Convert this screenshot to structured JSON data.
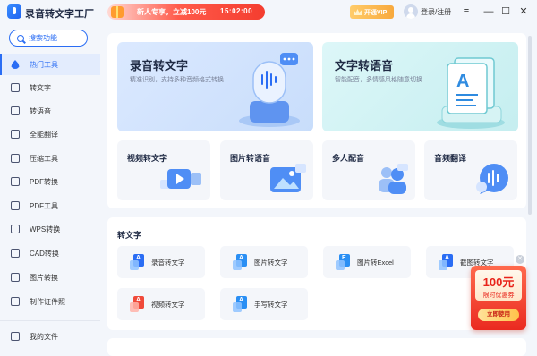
{
  "app": {
    "title": "录音转文字工厂"
  },
  "promo": {
    "text": "新人专享，立减100元",
    "countdown": "15:02:00"
  },
  "header": {
    "vip_label": "开通VIP",
    "login_label": "登录/注册",
    "menu_icon": "≡",
    "minimize_icon": "—",
    "maximize_icon": "☐",
    "close_icon": "✕"
  },
  "sidebar": {
    "search_label": "搜索功能",
    "items": [
      {
        "label": "热门工具",
        "icon": "flame-icon",
        "active": true
      },
      {
        "label": "转文字",
        "icon": "text-convert-icon"
      },
      {
        "label": "转语音",
        "icon": "voice-convert-icon"
      },
      {
        "label": "全能翻译",
        "icon": "translate-icon"
      },
      {
        "label": "压缩工具",
        "icon": "compress-icon"
      },
      {
        "label": "PDF转换",
        "icon": "pdf-convert-icon"
      },
      {
        "label": "PDF工具",
        "icon": "pdf-tool-icon"
      },
      {
        "label": "WPS转换",
        "icon": "wps-icon"
      },
      {
        "label": "CAD转换",
        "icon": "cad-icon"
      },
      {
        "label": "图片转换",
        "icon": "image-convert-icon"
      },
      {
        "label": "制作证件照",
        "icon": "id-photo-icon"
      }
    ],
    "footer_item": {
      "label": "我的文件",
      "icon": "folder-icon"
    }
  },
  "hero": [
    {
      "title": "录音转文字",
      "subtitle": "精准识别，支持多种音频格式转换"
    },
    {
      "title": "文字转语音",
      "subtitle": "智能配音，多情感风格随意切换"
    }
  ],
  "tools": [
    {
      "title": "视频转文字"
    },
    {
      "title": "图片转语音"
    },
    {
      "title": "多人配音"
    },
    {
      "title": "音频翻译"
    }
  ],
  "section": {
    "title": "转文字"
  },
  "chips": [
    {
      "label": "录音转文字",
      "badge": "A"
    },
    {
      "label": "图片转文字",
      "badge": "A"
    },
    {
      "label": "图片转Excel",
      "badge": "E"
    },
    {
      "label": "截图转文字",
      "badge": "A"
    },
    {
      "label": "视频转文字",
      "badge": "A"
    },
    {
      "label": "手写转文字",
      "badge": "A"
    }
  ],
  "coupon": {
    "amount": "100元",
    "label": "限时优惠券",
    "button": "立即使用"
  },
  "colors": {
    "accent": "#2a6df4",
    "promo": "#f43d2f",
    "coupon": "#ea2a20"
  }
}
